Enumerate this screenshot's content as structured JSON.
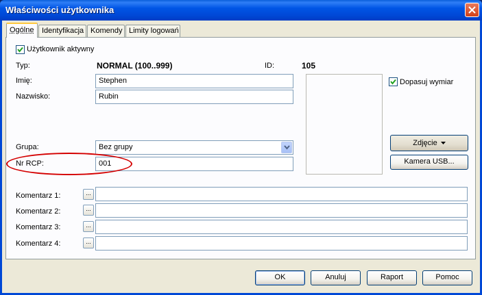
{
  "window": {
    "title": "Właściwości użytkownika"
  },
  "tabs": [
    {
      "label": "Ogólne"
    },
    {
      "label": "Identyfikacja"
    },
    {
      "label": "Komendy"
    },
    {
      "label": "Limity logowań"
    }
  ],
  "form": {
    "active_checkbox_label": "Użytkownik aktywny",
    "active_checked": true,
    "type_label": "Typ:",
    "type_value": "NORMAL (100..999)",
    "id_label": "ID:",
    "id_value": "105",
    "first_name_label": "Imię:",
    "first_name_value": "Stephen",
    "last_name_label": "Nazwisko:",
    "last_name_value": "Rubin",
    "group_label": "Grupa:",
    "group_value": "Bez grupy",
    "rcp_label": "Nr RCP:",
    "rcp_value": "001",
    "fit_checkbox_label": "Dopasuj wymiar",
    "fit_checked": true,
    "photo_button": "Zdjęcie",
    "usb_camera_button": "Kamera USB...",
    "comments": [
      {
        "label": "Komentarz 1:",
        "value": "",
        "button": "..."
      },
      {
        "label": "Komentarz 2:",
        "value": "",
        "button": "..."
      },
      {
        "label": "Komentarz 3:",
        "value": "",
        "button": "..."
      },
      {
        "label": "Komentarz 4:",
        "value": "",
        "button": "..."
      }
    ]
  },
  "footer": {
    "ok": "OK",
    "cancel": "Anuluj",
    "report": "Raport",
    "help": "Pomoc"
  },
  "colors": {
    "titlebar": "#0055e5",
    "dialog_bg": "#ece9d8",
    "annotation": "#d40000"
  }
}
